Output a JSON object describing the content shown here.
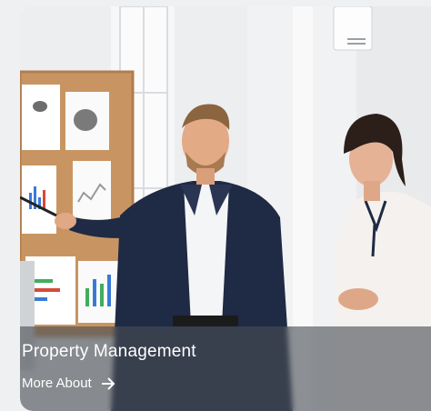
{
  "card": {
    "title": "Property Management",
    "link_label": "More About",
    "link_icon": "arrow-right-icon",
    "image_alt": "photo-office-meeting",
    "colors": {
      "overlay": "#484e54",
      "text": "#ffffff",
      "page_background": "#eef0f2"
    }
  }
}
